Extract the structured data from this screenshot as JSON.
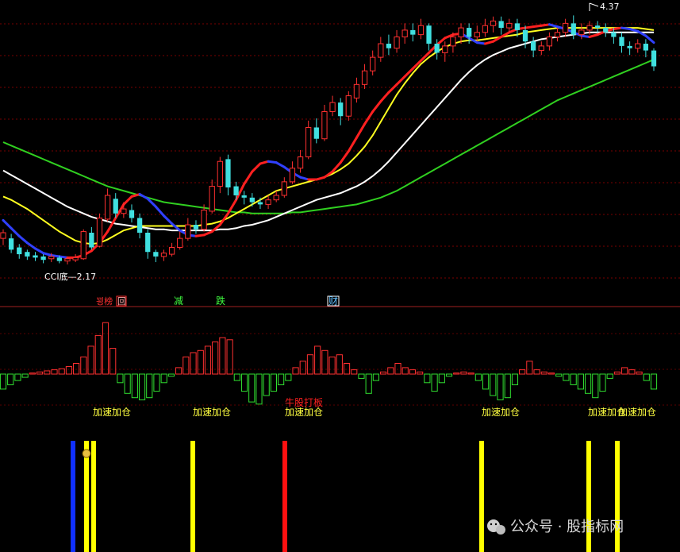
{
  "chart_data": {
    "type": "candlestick",
    "price_panel": {
      "high_label": "4.37",
      "low_label": "CCI底—2.17",
      "ylim": [
        2.05,
        4.45
      ],
      "grid": true,
      "moving_averages": [
        {
          "color": "#3040ff",
          "alt_color": "#ff2020",
          "values": [
            2.56,
            2.49,
            2.42,
            2.36,
            2.31,
            2.27,
            2.25,
            2.24,
            2.23,
            2.23,
            2.25,
            2.29,
            2.36,
            2.46,
            2.58,
            2.7,
            2.77,
            2.79,
            2.75,
            2.68,
            2.6,
            2.53,
            2.47,
            2.43,
            2.42,
            2.43,
            2.46,
            2.52,
            2.62,
            2.74,
            2.88,
            2.99,
            3.06,
            3.08,
            3.07,
            3.03,
            2.98,
            2.94,
            2.92,
            2.92,
            2.94,
            2.99,
            3.07,
            3.17,
            3.29,
            3.41,
            3.52,
            3.61,
            3.69,
            3.76,
            3.83,
            3.9,
            3.97,
            4.04,
            4.11,
            4.17,
            4.2,
            4.21,
            4.17,
            4.13,
            4.12,
            4.14,
            4.18,
            4.22,
            4.25,
            4.26,
            4.27,
            4.28,
            4.29,
            4.27,
            4.25,
            4.22,
            4.19,
            4.18,
            4.2,
            4.23,
            4.25,
            4.26,
            4.25,
            4.23,
            4.19,
            4.13
          ]
        },
        {
          "color": "#ffff20",
          "values": [
            2.77,
            2.74,
            2.7,
            2.66,
            2.61,
            2.56,
            2.51,
            2.46,
            2.42,
            2.38,
            2.36,
            2.35,
            2.36,
            2.39,
            2.43,
            2.47,
            2.49,
            2.51,
            2.51,
            2.51,
            2.51,
            2.51,
            2.51,
            2.51,
            2.51,
            2.52,
            2.53,
            2.55,
            2.58,
            2.62,
            2.66,
            2.7,
            2.74,
            2.78,
            2.82,
            2.84,
            2.86,
            2.88,
            2.9,
            2.92,
            2.94,
            2.97,
            3.01,
            3.06,
            3.13,
            3.21,
            3.31,
            3.43,
            3.55,
            3.67,
            3.77,
            3.86,
            3.94,
            4.0,
            4.05,
            4.09,
            4.12,
            4.14,
            4.15,
            4.15,
            4.16,
            4.17,
            4.18,
            4.19,
            4.2,
            4.22,
            4.23,
            4.24,
            4.25,
            4.26,
            4.26,
            4.26,
            4.26,
            4.26,
            4.26,
            4.26,
            4.26,
            4.26,
            4.26,
            4.26,
            4.25,
            4.24
          ]
        },
        {
          "color": "#ffffff",
          "values": [
            3.0,
            2.96,
            2.92,
            2.88,
            2.84,
            2.8,
            2.76,
            2.72,
            2.68,
            2.65,
            2.62,
            2.59,
            2.57,
            2.55,
            2.53,
            2.52,
            2.51,
            2.5,
            2.49,
            2.48,
            2.48,
            2.47,
            2.47,
            2.47,
            2.47,
            2.47,
            2.47,
            2.48,
            2.48,
            2.49,
            2.51,
            2.52,
            2.54,
            2.56,
            2.59,
            2.62,
            2.65,
            2.68,
            2.71,
            2.74,
            2.76,
            2.78,
            2.8,
            2.83,
            2.86,
            2.9,
            2.95,
            3.01,
            3.08,
            3.16,
            3.24,
            3.32,
            3.4,
            3.48,
            3.56,
            3.64,
            3.72,
            3.8,
            3.87,
            3.93,
            3.98,
            4.02,
            4.05,
            4.08,
            4.1,
            4.12,
            4.14,
            4.16,
            4.17,
            4.18,
            4.19,
            4.2,
            4.21,
            4.22,
            4.22,
            4.22,
            4.22,
            4.22,
            4.22,
            4.22,
            4.22,
            4.22
          ]
        },
        {
          "color": "#30d020",
          "values": [
            3.25,
            3.22,
            3.19,
            3.16,
            3.13,
            3.1,
            3.07,
            3.04,
            3.01,
            2.98,
            2.95,
            2.92,
            2.89,
            2.86,
            2.84,
            2.82,
            2.8,
            2.78,
            2.76,
            2.74,
            2.72,
            2.71,
            2.7,
            2.69,
            2.68,
            2.67,
            2.66,
            2.65,
            2.64,
            2.63,
            2.63,
            2.62,
            2.62,
            2.62,
            2.62,
            2.62,
            2.63,
            2.63,
            2.64,
            2.65,
            2.66,
            2.67,
            2.68,
            2.69,
            2.7,
            2.72,
            2.74,
            2.76,
            2.79,
            2.82,
            2.86,
            2.9,
            2.94,
            2.98,
            3.02,
            3.06,
            3.1,
            3.14,
            3.18,
            3.22,
            3.26,
            3.3,
            3.34,
            3.38,
            3.42,
            3.46,
            3.5,
            3.54,
            3.58,
            3.62,
            3.65,
            3.68,
            3.71,
            3.74,
            3.77,
            3.8,
            3.83,
            3.86,
            3.89,
            3.92,
            3.95,
            3.98
          ]
        }
      ],
      "candles": [
        [
          2.4,
          2.45,
          2.48,
          2.34
        ],
        [
          2.4,
          2.3,
          2.44,
          2.27
        ],
        [
          2.32,
          2.26,
          2.35,
          2.22
        ],
        [
          2.28,
          2.24,
          2.3,
          2.21
        ],
        [
          2.25,
          2.23,
          2.28,
          2.2
        ],
        [
          2.24,
          2.21,
          2.26,
          2.18
        ],
        [
          2.22,
          2.24,
          2.27,
          2.19
        ],
        [
          2.23,
          2.2,
          2.25,
          2.18
        ],
        [
          2.2,
          2.22,
          2.24,
          2.17
        ],
        [
          2.21,
          2.23,
          2.26,
          2.19
        ],
        [
          2.22,
          2.46,
          2.48,
          2.21
        ],
        [
          2.45,
          2.32,
          2.5,
          2.3
        ],
        [
          2.33,
          2.58,
          2.62,
          2.32
        ],
        [
          2.57,
          2.78,
          2.84,
          2.55
        ],
        [
          2.75,
          2.62,
          2.8,
          2.58
        ],
        [
          2.62,
          2.66,
          2.72,
          2.58
        ],
        [
          2.65,
          2.58,
          2.7,
          2.54
        ],
        [
          2.58,
          2.45,
          2.62,
          2.4
        ],
        [
          2.45,
          2.28,
          2.48,
          2.22
        ],
        [
          2.28,
          2.24,
          2.3,
          2.19
        ],
        [
          2.24,
          2.27,
          2.3,
          2.2
        ],
        [
          2.26,
          2.32,
          2.36,
          2.24
        ],
        [
          2.32,
          2.4,
          2.46,
          2.3
        ],
        [
          2.4,
          2.52,
          2.58,
          2.38
        ],
        [
          2.52,
          2.48,
          2.56,
          2.44
        ],
        [
          2.48,
          2.65,
          2.7,
          2.46
        ],
        [
          2.64,
          2.86,
          2.92,
          2.62
        ],
        [
          2.86,
          3.08,
          3.12,
          2.8
        ],
        [
          3.1,
          2.85,
          3.14,
          2.78
        ],
        [
          2.86,
          2.78,
          2.9,
          2.74
        ],
        [
          2.78,
          2.76,
          2.82,
          2.7
        ],
        [
          2.76,
          2.72,
          2.8,
          2.68
        ],
        [
          2.72,
          2.7,
          2.76,
          2.66
        ],
        [
          2.7,
          2.74,
          2.78,
          2.66
        ],
        [
          2.74,
          2.78,
          2.82,
          2.72
        ],
        [
          2.78,
          2.9,
          2.94,
          2.76
        ],
        [
          2.9,
          3.02,
          3.08,
          2.88
        ],
        [
          3.02,
          3.12,
          3.18,
          2.98
        ],
        [
          3.12,
          3.38,
          3.44,
          3.1
        ],
        [
          3.38,
          3.28,
          3.46,
          3.24
        ],
        [
          3.28,
          3.52,
          3.58,
          3.26
        ],
        [
          3.52,
          3.6,
          3.66,
          3.48
        ],
        [
          3.6,
          3.48,
          3.64,
          3.4
        ],
        [
          3.48,
          3.66,
          3.7,
          3.44
        ],
        [
          3.64,
          3.76,
          3.82,
          3.6
        ],
        [
          3.76,
          3.88,
          3.94,
          3.72
        ],
        [
          3.88,
          4.0,
          4.06,
          3.84
        ],
        [
          4.0,
          4.12,
          4.18,
          3.96
        ],
        [
          4.12,
          4.08,
          4.2,
          4.02
        ],
        [
          4.08,
          4.18,
          4.24,
          4.04
        ],
        [
          4.18,
          4.24,
          4.3,
          4.12
        ],
        [
          4.24,
          4.2,
          4.3,
          4.14
        ],
        [
          4.2,
          4.28,
          4.34,
          4.16
        ],
        [
          4.28,
          4.12,
          4.3,
          4.06
        ],
        [
          4.12,
          4.04,
          4.16,
          3.98
        ],
        [
          4.04,
          4.1,
          4.14,
          3.96
        ],
        [
          4.1,
          4.18,
          4.22,
          4.04
        ],
        [
          4.18,
          4.26,
          4.3,
          4.12
        ],
        [
          4.26,
          4.18,
          4.3,
          4.12
        ],
        [
          4.18,
          4.22,
          4.28,
          4.14
        ],
        [
          4.22,
          4.28,
          4.34,
          4.18
        ],
        [
          4.28,
          4.32,
          4.36,
          4.22
        ],
        [
          4.32,
          4.26,
          4.36,
          4.2
        ],
        [
          4.26,
          4.3,
          4.34,
          4.22
        ],
        [
          4.3,
          4.24,
          4.34,
          4.18
        ],
        [
          4.24,
          4.14,
          4.28,
          4.08
        ],
        [
          4.14,
          4.06,
          4.18,
          4.0
        ],
        [
          4.06,
          4.1,
          4.14,
          4.02
        ],
        [
          4.1,
          4.18,
          4.22,
          4.06
        ],
        [
          4.18,
          4.22,
          4.26,
          4.14
        ],
        [
          4.22,
          4.3,
          4.34,
          4.18
        ],
        [
          4.3,
          4.2,
          4.37,
          4.16
        ],
        [
          4.2,
          4.24,
          4.3,
          4.16
        ],
        [
          4.24,
          4.28,
          4.32,
          4.2
        ],
        [
          4.28,
          4.26,
          4.32,
          4.22
        ],
        [
          4.26,
          4.22,
          4.3,
          4.18
        ],
        [
          4.22,
          4.18,
          4.26,
          4.12
        ],
        [
          4.18,
          4.1,
          4.22,
          4.04
        ],
        [
          4.1,
          4.08,
          4.14,
          4.02
        ],
        [
          4.08,
          4.12,
          4.16,
          4.04
        ],
        [
          4.12,
          4.06,
          4.16,
          4.0
        ],
        [
          4.06,
          3.92,
          4.08,
          3.88
        ]
      ]
    },
    "indicator_panel": {
      "histogram": [
        -0.7,
        -0.5,
        -0.3,
        -0.15,
        0.05,
        0.1,
        0.15,
        0.2,
        0.25,
        0.35,
        0.5,
        0.8,
        1.3,
        1.8,
        2.4,
        1.2,
        -0.4,
        -0.9,
        -1.1,
        -1.2,
        -1.1,
        -0.8,
        -0.4,
        -0.1,
        0.3,
        0.8,
        1.0,
        1.1,
        1.3,
        1.5,
        1.7,
        1.6,
        -0.3,
        -0.8,
        -1.3,
        -1.4,
        -1.0,
        -0.8,
        -0.5,
        -0.3,
        0.3,
        0.6,
        0.9,
        1.3,
        1.1,
        0.8,
        0.9,
        0.5,
        0.2,
        -0.2,
        -0.9,
        -0.3,
        0.1,
        0.3,
        0.5,
        0.3,
        0.2,
        0.1,
        -0.4,
        -0.8,
        -0.4,
        -0.1,
        0.05,
        0.1,
        0.05,
        -0.3,
        -0.7,
        -1.0,
        -1.2,
        -1.1,
        -0.5,
        0.2,
        0.6,
        0.2,
        0.1,
        0.05,
        -0.1,
        -0.3,
        -0.5,
        -0.7,
        -0.9,
        -1.1,
        -0.8,
        -0.2,
        0.1,
        0.3,
        0.2,
        0.1,
        -0.3,
        -0.7
      ],
      "tags": [
        "꾕榜",
        "回",
        "减",
        "跌",
        "财"
      ],
      "annotations": [
        "加速加仓",
        "加速加仓",
        "加速加仓",
        "牛股打板",
        "加速加仓",
        "加速加仓",
        "加速加仓"
      ]
    },
    "signal_panel": {
      "signal_bars": [
        {
          "color": "#1030ff"
        },
        {
          "color": "#ffff00",
          "icon": "money-bag-icon"
        },
        {
          "color": "#ffff00"
        },
        {
          "color": "#ffff00"
        },
        {
          "color": "#ff1010"
        },
        {
          "color": "#ffff00"
        },
        {
          "color": "#ffff00"
        },
        {
          "color": "#ffff00"
        }
      ]
    }
  },
  "watermark": {
    "text": "公众号 · 股指标网",
    "icon": "wechat-icon"
  }
}
